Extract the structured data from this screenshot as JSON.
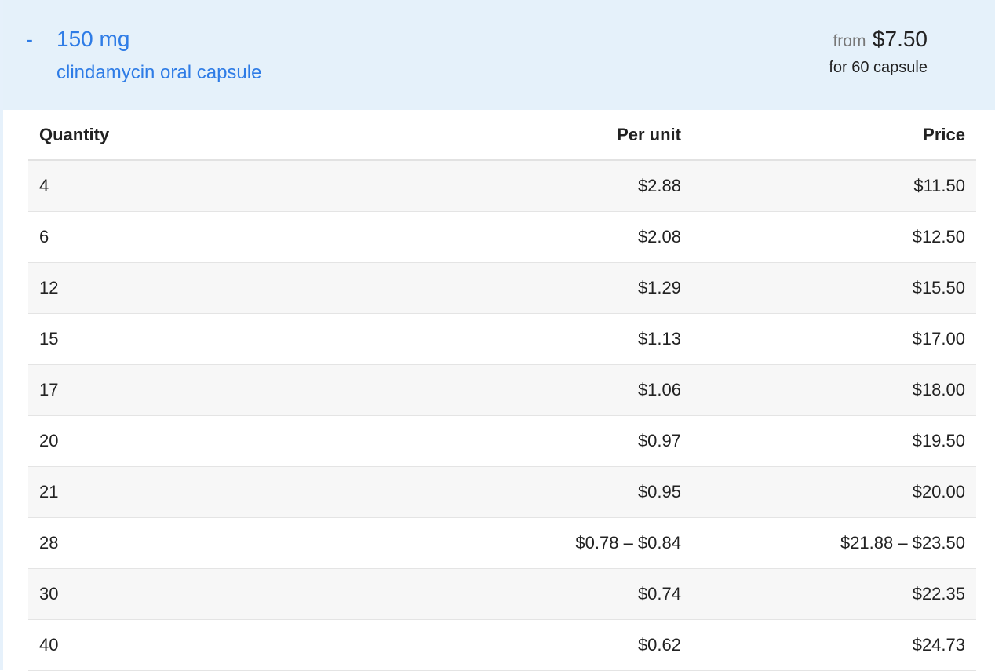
{
  "header": {
    "toggle": "-",
    "strength": "150 mg",
    "drug_name": "clindamycin oral capsule",
    "from_label": "from",
    "from_price": "$7.50",
    "for_quantity": "for 60 capsule"
  },
  "table": {
    "columns": [
      "Quantity",
      "Per unit",
      "Price"
    ],
    "rows": [
      {
        "quantity": "4",
        "per_unit": "$2.88",
        "price": "$11.50"
      },
      {
        "quantity": "6",
        "per_unit": "$2.08",
        "price": "$12.50"
      },
      {
        "quantity": "12",
        "per_unit": "$1.29",
        "price": "$15.50"
      },
      {
        "quantity": "15",
        "per_unit": "$1.13",
        "price": "$17.00"
      },
      {
        "quantity": "17",
        "per_unit": "$1.06",
        "price": "$18.00"
      },
      {
        "quantity": "20",
        "per_unit": "$0.97",
        "price": "$19.50"
      },
      {
        "quantity": "21",
        "per_unit": "$0.95",
        "price": "$20.00"
      },
      {
        "quantity": "28",
        "per_unit": "$0.78 – $0.84",
        "price": "$21.88 – $23.50"
      },
      {
        "quantity": "30",
        "per_unit": "$0.74",
        "price": "$22.35"
      },
      {
        "quantity": "40",
        "per_unit": "$0.62",
        "price": "$24.73"
      }
    ]
  },
  "colors": {
    "link": "#2e7ce6",
    "header_bg": "#e5f1fa",
    "stripe": "#f7f7f7"
  }
}
